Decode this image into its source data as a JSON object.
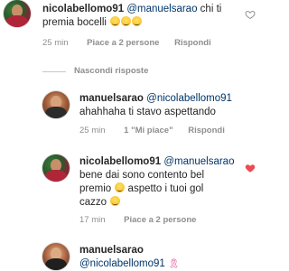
{
  "comments": [
    {
      "username": "nicolabellomo91",
      "mention": "@manuelsarao",
      "text_line1": " chi ti",
      "text_line2": "premia bocelli",
      "emojis": [
        "laugh-emoji",
        "laugh-emoji",
        "laugh-emoji"
      ],
      "time": "25 min",
      "likes": "Piace a 2 persone",
      "reply": "Rispondi",
      "liked": false
    },
    {
      "username": "manuelsarao",
      "mention": "@nicolabellomo91",
      "text_line1": "ahahhaha ti stavo aspettando",
      "time": "25 min",
      "likes": "1 \"Mi piace\"",
      "reply": "Rispondi",
      "liked": false
    },
    {
      "username": "nicolabellomo91",
      "mention": "@manuelsarao",
      "text_line1": "bene dai sono contento bel",
      "text_line2": "premio",
      "text_line2b": " aspetto i tuoi gol",
      "text_line3": "cazzo",
      "emojis": [
        "wink-emoji",
        "smirk-emoji"
      ],
      "time": "17 min",
      "likes": "Piace a 2 persone",
      "reply": "Rispondi",
      "liked": true
    },
    {
      "username": "manuelsarao",
      "mention": "@nicolabellomo91",
      "icon": "ribbon-icon"
    }
  ],
  "hide_replies": "Nascondi risposte",
  "colors": {
    "heart_red": "#ed4956",
    "mention_blue": "#003569",
    "meta_gray": "#8e8e8e"
  },
  "icons": [
    "heart-outline-icon",
    "heart-filled-icon",
    "ribbon-icon"
  ]
}
